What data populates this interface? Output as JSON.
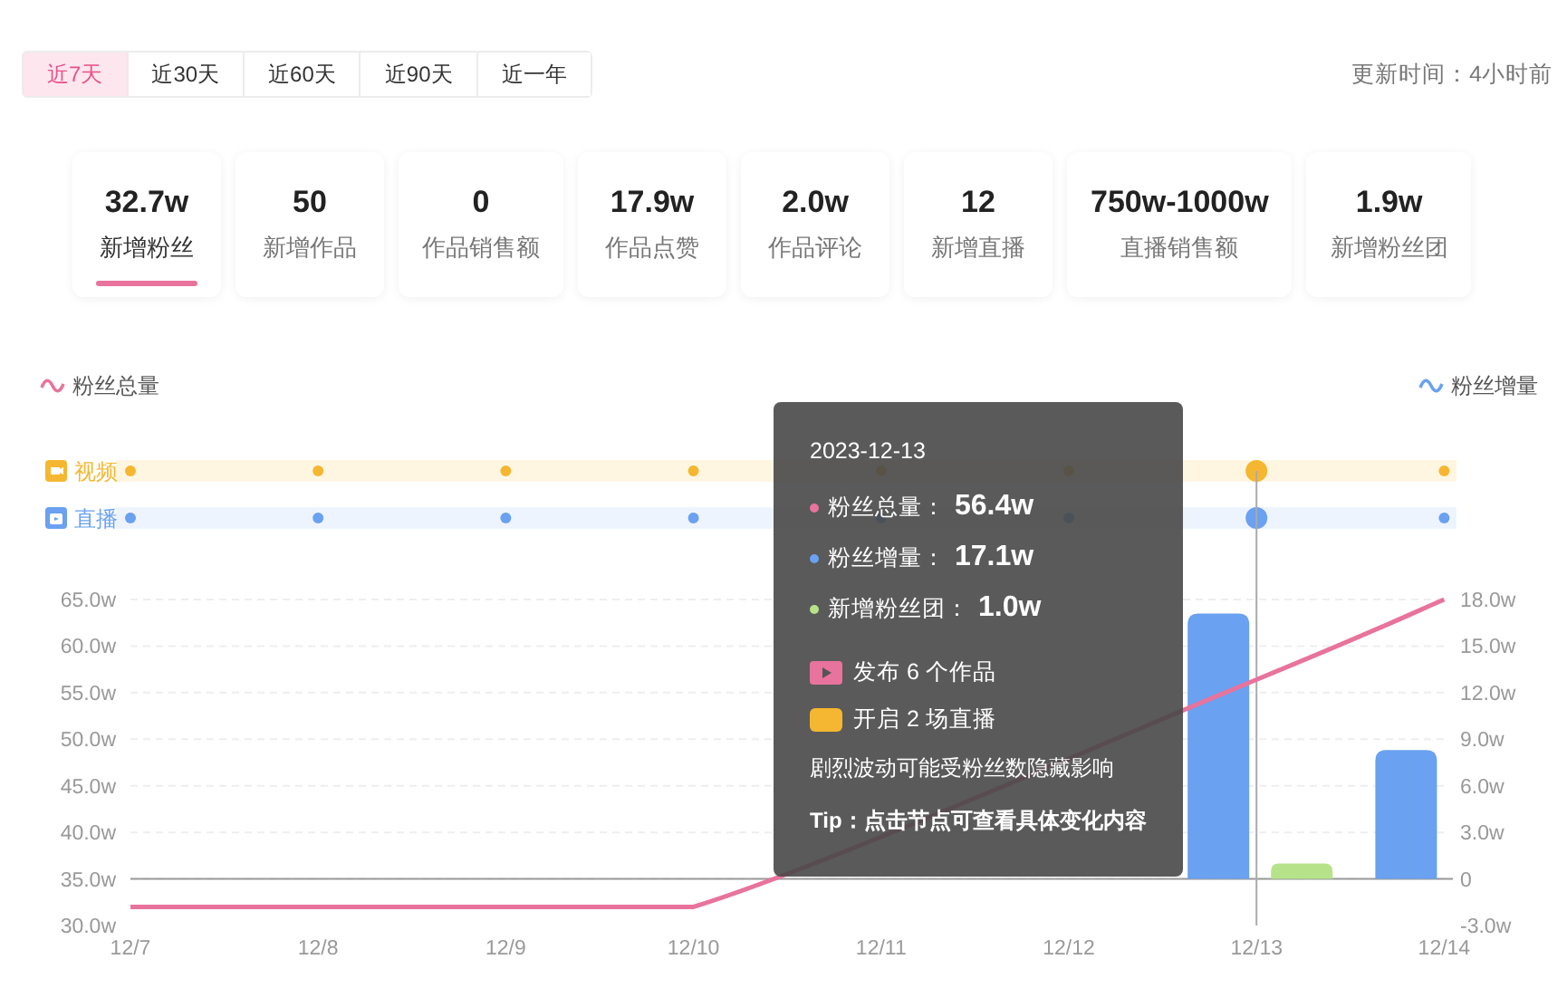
{
  "range_tabs": [
    {
      "label": "近7天",
      "selected": true
    },
    {
      "label": "近30天",
      "selected": false
    },
    {
      "label": "近60天",
      "selected": false
    },
    {
      "label": "近90天",
      "selected": false
    },
    {
      "label": "近一年",
      "selected": false
    }
  ],
  "update_time": "更新时间：4小时前",
  "stats": [
    {
      "value": "32.7w",
      "label": "新增粉丝",
      "selected": true
    },
    {
      "value": "50",
      "label": "新增作品",
      "selected": false
    },
    {
      "value": "0",
      "label": "作品销售额",
      "selected": false
    },
    {
      "value": "17.9w",
      "label": "作品点赞",
      "selected": false
    },
    {
      "value": "2.0w",
      "label": "作品评论",
      "selected": false
    },
    {
      "value": "12",
      "label": "新增直播",
      "selected": false
    },
    {
      "value": "750w-1000w",
      "label": "直播销售额",
      "selected": false
    },
    {
      "value": "1.9w",
      "label": "新增粉丝团",
      "selected": false
    }
  ],
  "timeline": [
    {
      "label": "视频",
      "kind": "video",
      "dots": [
        {
          "selected": false
        },
        {
          "selected": false
        },
        {
          "selected": false
        },
        {
          "selected": false
        },
        {
          "selected": false
        },
        {
          "selected": false
        },
        {
          "selected": true
        },
        {
          "selected": false
        }
      ]
    },
    {
      "label": "直播",
      "kind": "live",
      "dots": [
        {
          "selected": false
        },
        {
          "selected": false
        },
        {
          "selected": false
        },
        {
          "selected": false
        },
        {
          "selected": false
        },
        {
          "selected": false
        },
        {
          "selected": true
        },
        {
          "selected": false
        }
      ]
    }
  ],
  "chart_data": {
    "type": "bar",
    "categories": [
      "12/7",
      "12/8",
      "12/9",
      "12/10",
      "12/11",
      "12/12",
      "12/13",
      "12/14"
    ],
    "stacked": false,
    "grid": true,
    "ref_lines": [
      {
        "axis": "x",
        "value": "12/13",
        "color": "#aaaaaa"
      }
    ],
    "series": [
      {
        "name": "粉丝总量",
        "type": "line",
        "color": "#e8739c",
        "values": [
          32,
          32,
          32,
          32,
          null,
          null,
          56.4,
          65
        ]
      },
      {
        "name": "粉丝增量",
        "type": "bar",
        "axis": "y2",
        "color": "#6aa1f0",
        "values": [
          null,
          null,
          null,
          null,
          null,
          null,
          17.1,
          8.3
        ]
      },
      {
        "type": "bar",
        "axis": "y2",
        "color": "#b6e38a",
        "values": [
          null,
          null,
          null,
          null,
          null,
          null,
          1.0,
          null
        ]
      }
    ],
    "ylim": [
      30,
      65
    ],
    "yticks": [
      {
        "value": 30,
        "label": "30.0w"
      },
      {
        "value": 35,
        "label": "35.0w"
      },
      {
        "value": 40,
        "label": "40.0w"
      },
      {
        "value": 45,
        "label": "45.0w"
      },
      {
        "value": 50,
        "label": "50.0w"
      },
      {
        "value": 55,
        "label": "55.0w"
      },
      {
        "value": 60,
        "label": "60.0w"
      },
      {
        "value": 65,
        "label": "65.0w"
      }
    ],
    "y2lim": [
      -3,
      18
    ],
    "y2ticks": [
      {
        "value": -3,
        "label": "-3.0w"
      },
      {
        "value": 0,
        "label": "0"
      },
      {
        "value": 3,
        "label": "3.0w"
      },
      {
        "value": 6,
        "label": "6.0w"
      },
      {
        "value": 9,
        "label": "9.0w"
      },
      {
        "value": 12,
        "label": "12.0w"
      },
      {
        "value": 15,
        "label": "15.0w"
      },
      {
        "value": 18,
        "label": "18.0w"
      }
    ]
  },
  "tooltip": {
    "date": "2023-12-13",
    "metrics": [
      {
        "label": "粉丝总量：",
        "value": "56.4w",
        "color": "#e8739c"
      },
      {
        "label": "粉丝增量：",
        "value": "17.1w",
        "color": "#6aa1f0"
      },
      {
        "label": "新增粉丝团：",
        "value": "1.0w",
        "color": "#b6e38a"
      }
    ],
    "events": [
      {
        "kind": "video",
        "text": "发布 6 个作品"
      },
      {
        "kind": "live",
        "text": "开启 2 场直播"
      }
    ],
    "note": "剧烈波动可能受粉丝数隐藏影响",
    "tip": "Tip：点击节点可查看具体变化内容"
  }
}
